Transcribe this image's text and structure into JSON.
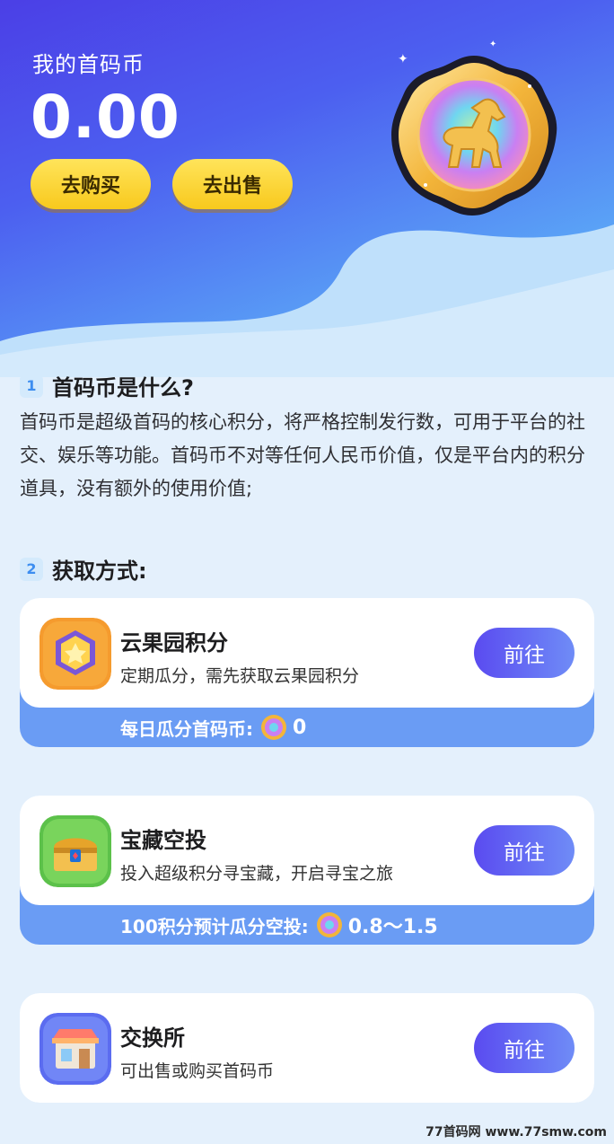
{
  "header": {
    "balance_label": "我的首码币",
    "balance_value": "0.00",
    "buy_label": "去购买",
    "sell_label": "去出售"
  },
  "section1": {
    "number": "1",
    "title": "首码币是什么?",
    "description": "首码币是超级首码的核心积分，将严格控制发行数，可用于平台的社交、娱乐等功能。首码币不对等任何人民币价值，仅是平台内的积分道具，没有额外的使用价值;"
  },
  "section2": {
    "number": "2",
    "title": "获取方式:"
  },
  "cards": [
    {
      "title": "云果园积分",
      "subtitle": "定期瓜分，需先获取云果园积分",
      "button": "前往",
      "footer_label": "每日瓜分首码币:",
      "footer_value": "0"
    },
    {
      "title": "宝藏空投",
      "subtitle": "投入超级积分寻宝藏，开启寻宝之旅",
      "button": "前往",
      "footer_label": "100积分预计瓜分空投:",
      "footer_value": "0.8～1.5"
    },
    {
      "title": "交换所",
      "subtitle": "可出售或购买首码币",
      "button": "前往"
    }
  ],
  "watermark": "77首码网 www.77smw.com",
  "colors": {
    "accent_yellow": "#f8c91d",
    "accent_purple": "#5a4bf0",
    "card_footer": "#6a9cf4"
  }
}
